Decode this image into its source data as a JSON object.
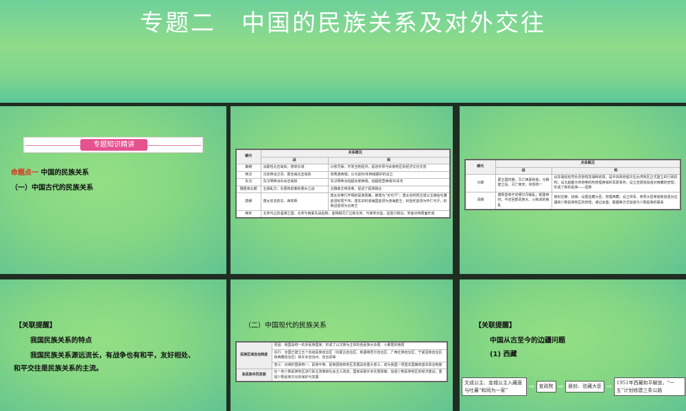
{
  "title": "专题二　中国的民族关系及对外交往",
  "slide1": {
    "ribbon": "专题知识精讲",
    "topic_label": "命题点一",
    "topic": "中国的民族关系",
    "subtopic": "（一）中国古代的民族关系"
  },
  "slide2": {
    "header_dynasty": "朝代",
    "header_relation": "关系概况",
    "header_war": "战",
    "header_peace": "和",
    "rows": [
      [
        "秦朝",
        "派蒙恬北击匈奴，修筑长城",
        "兴修灵渠，开发当地经济，促进中原与岭南地区的经济文化交流"
      ],
      [
        "西汉",
        "汉武帝派卫青、霍去病北击匈奴",
        "张骞通西域；公元前60年西域都护的设立"
      ],
      [
        "东汉",
        "东汉明帝派兵出击匈奴",
        "东汉明帝派班超出使西域，班超经营西域30多年"
      ],
      [
        "魏晋南北朝",
        "五胡乱华；东晋和前秦的淝水之战",
        "北魏孝文帝改革，促进了民族融合"
      ],
      [
        "唐朝",
        "唐太宗击败东、西突厥",
        "唐太宗奉行开明的民族政策，被尊为“天可汗”；唐太宗时把文成公主嫁给吐蕃首领松赞干布；唐玄宗封渤海国首领为渤海郡王，封回纥首领为怀仁可汗，封南诏首领为云南王"
      ]
    ],
    "song_row": [
      "两宋",
      "北宋与辽的澶渊之盟；北宋与西夏先战后和；金相继灭亡辽和北宋，与南宋对垒，后签订和议，宋金对峙局面形成"
    ]
  },
  "slide3": {
    "header_dynasty": "朝代",
    "header_relation": "关系概况",
    "header_war": "战",
    "header_peace": "和",
    "rows": [
      [
        "元朝",
        "蒙古国时期，灭亡西夏和金；元朝建立后，灭亡南宋，实现统一",
        "设澎湖巡检司负责管辖澎湖和琉球，是中央政府首次在台湾地区正式建立的行政机构；设北庭都元帅府等机构管理西域的军政事务；设立宣政院加强对西藏的管辖；形成了新的民族——回族"
      ],
      [
        "清朝",
        "康熙皇帝平定噶尔丹叛乱；乾隆帝时，平定回部贵族大、小和卓的叛乱",
        "册封达赖、班禅，设置驻藏大臣，管理西藏；设立将军、参赞大臣等官职加强对边疆和少数民族地区的管辖；通过会盟、联姻等方式加强与少数民族的联系"
      ]
    ]
  },
  "slide4": {
    "label": "【关联提醒】",
    "heading": "我国民族关系的特点",
    "body1": "我国民族关系源远流长，有战争也有和平，友好相处、",
    "body2": "和平交往是民族关系的主流。"
  },
  "slide5": {
    "subtopic": "（二）中国现代的民族关系",
    "system_label": "民族区域自治制度",
    "system_rows": [
      "原因：我国是统一的多民族国家，形成了以汉族为主体的各民族大杂居、小聚居的格局",
      "实行：全国已建立五个省级民族自治区（内蒙古自治区、新疆维吾尔自治区、广西壮族自治区、宁夏回族自治区和西藏自治区）和许多自治州、自治县等",
      "意义：对维护国家统一，民族平等，民族团结和地区发展具有重大意义，成为我国一项基本国策和基本政治制度"
    ],
    "dev_label": "各民族共同发展",
    "dev_text": "在一些少数民族地区进行民主改革和社会主义改造；国家采取许多优惠政策，加强少数民族地区的经济建设；重视少数民族文化的保护与发展"
  },
  "slide6": {
    "label": "【关联提醒】",
    "heading": "中国从古至今的边疆问题",
    "sub": "(1) 西藏",
    "flow": [
      "文成公主、金城公主入藏唐与吐蕃“和同为一家”",
      "宣政院",
      "册封、驻藏大臣",
      "1951年西藏和平解放，“一五”计划修建三条公路"
    ]
  }
}
